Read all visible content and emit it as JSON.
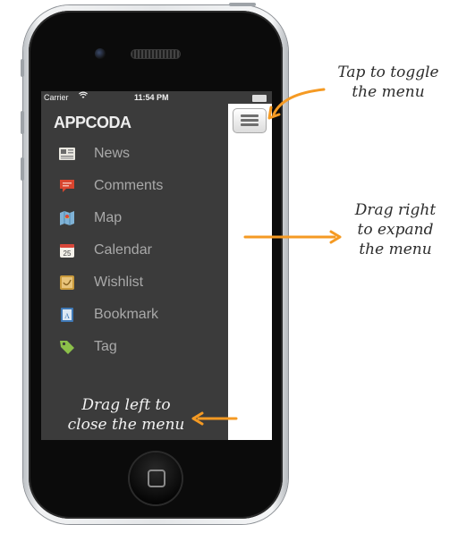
{
  "status_bar": {
    "carrier": "Carrier",
    "time": "11:54 PM"
  },
  "menu": {
    "brand": "APPCODA",
    "items": [
      {
        "label": "News",
        "icon": "newspaper-icon"
      },
      {
        "label": "Comments",
        "icon": "comment-icon"
      },
      {
        "label": "Map",
        "icon": "map-icon"
      },
      {
        "label": "Calendar",
        "icon": "calendar-icon"
      },
      {
        "label": "Wishlist",
        "icon": "wishlist-icon"
      },
      {
        "label": "Bookmark",
        "icon": "bookmark-icon"
      },
      {
        "label": "Tag",
        "icon": "tag-icon"
      }
    ]
  },
  "annotations": {
    "toggle_line1": "Tap to toggle",
    "toggle_line2": "the menu",
    "expand_line1": "Drag right",
    "expand_line2": "to expand",
    "expand_line3": "the menu",
    "close_line1": "Drag left to",
    "close_line2": "close the menu"
  },
  "colors": {
    "menu_background": "#3b3b3b",
    "arrow": "#f59a23",
    "label_text": "#a9a9a9"
  }
}
